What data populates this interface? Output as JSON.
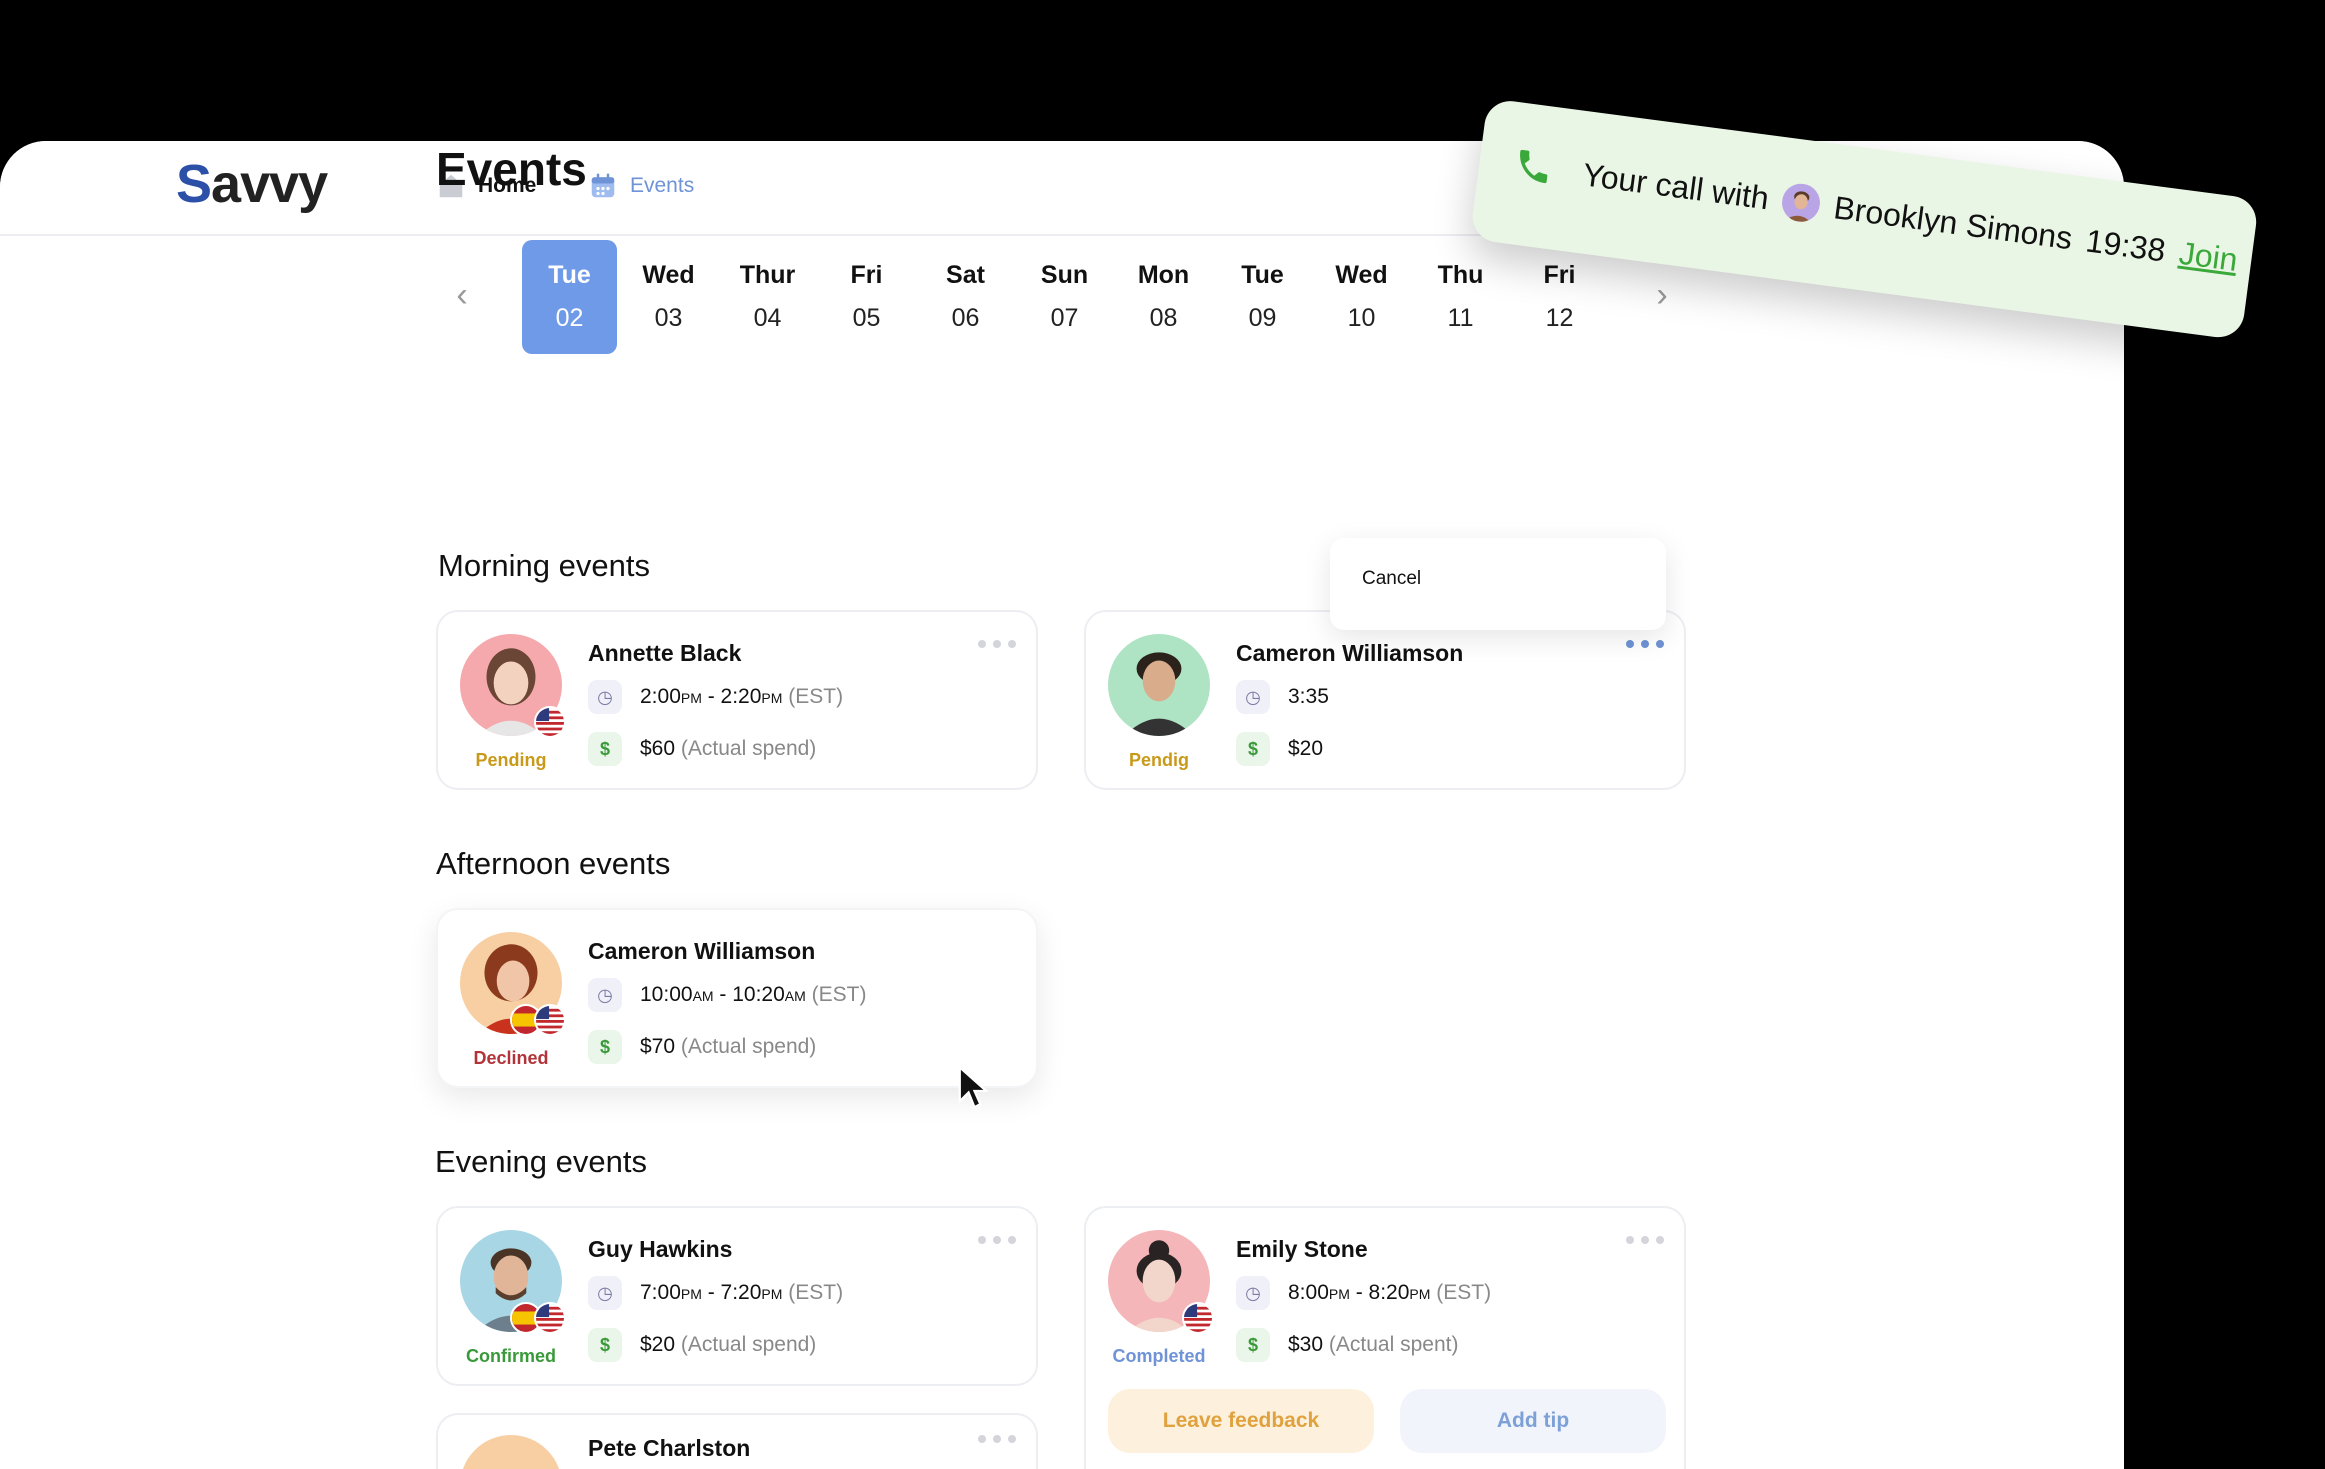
{
  "app": {
    "logo_first": "S",
    "logo_rest": "avvy"
  },
  "nav": {
    "home_label": "Home",
    "events_label": "Events"
  },
  "page": {
    "title": "Events"
  },
  "calendar": {
    "days": [
      {
        "name": "Tue",
        "num": "02",
        "active": true
      },
      {
        "name": "Wed",
        "num": "03"
      },
      {
        "name": "Thur",
        "num": "04"
      },
      {
        "name": "Fri",
        "num": "05"
      },
      {
        "name": "Sat",
        "num": "06"
      },
      {
        "name": "Sun",
        "num": "07"
      },
      {
        "name": "Mon",
        "num": "08"
      },
      {
        "name": "Tue",
        "num": "09"
      },
      {
        "name": "Wed",
        "num": "10"
      },
      {
        "name": "Thu",
        "num": "11"
      },
      {
        "name": "Fri",
        "num": "12"
      }
    ]
  },
  "sections": {
    "morning": "Morning events",
    "afternoon": "Afternoon events",
    "evening": "Evening events"
  },
  "events": {
    "m1": {
      "name": "Annette Black",
      "time_start": "2:00",
      "start_suffix": "PM",
      "time_end": "2:20",
      "end_suffix": "PM",
      "tz": "(EST)",
      "amount": "$60",
      "amount_note": "(Actual spend)",
      "status": "Pending"
    },
    "m2": {
      "name": "Cameron Williamson",
      "time_partial": "3:35",
      "amount_partial": "$20",
      "status": "Pendig"
    },
    "a1": {
      "name": "Cameron Williamson",
      "time_start": "10:00",
      "start_suffix": "AM",
      "time_end": "10:20",
      "end_suffix": "AM",
      "tz": "(EST)",
      "amount": "$70",
      "amount_note": "(Actual spend)",
      "status": "Declined"
    },
    "e1": {
      "name": "Guy Hawkins",
      "time_start": "7:00",
      "start_suffix": "PM",
      "time_end": "7:20",
      "end_suffix": "PM",
      "tz": "(EST)",
      "amount": "$20",
      "amount_note": "(Actual spend)",
      "status": "Confirmed"
    },
    "e2": {
      "name": "Emily Stone",
      "time_start": "8:00",
      "start_suffix": "PM",
      "time_end": "8:20",
      "end_suffix": "PM",
      "tz": "(EST)",
      "amount": "$30",
      "amount_note": "(Actual spent)",
      "status": "Completed",
      "feedback_label": "Leave feedback",
      "tip_label": "Add tip"
    },
    "e3": {
      "name": "Pete Charlston"
    }
  },
  "dropdown": {
    "cancel_label": "Cancel"
  },
  "toast": {
    "prefix": "Your call with",
    "person": "Brooklyn Simons",
    "time": "19:38",
    "join_label": "Join"
  },
  "icons": {
    "home": "home-icon",
    "calendar": "calendar-icon",
    "clock": "clock-icon",
    "dollar": "dollar-icon",
    "dots": "more-dots-icon",
    "phone": "phone-icon",
    "chevron_left": "chevron-left-icon",
    "chevron_right": "chevron-right-icon",
    "cursor": "mouse-cursor-icon"
  },
  "colors": {
    "accent": "#6f9ae8",
    "pending": "#c99a1a",
    "declined": "#b2343a",
    "confirmed": "#3a9a3a",
    "completed": "#6f93d6",
    "toast_bg": "#eaf6e5",
    "join": "#3aa83a"
  }
}
